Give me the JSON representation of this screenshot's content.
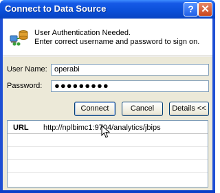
{
  "window": {
    "title": "Connect to Data Source",
    "help_button": "?",
    "close_button": "✕"
  },
  "header": {
    "icon": "data-source-connect-icon",
    "line1": "User Authentication Needed.",
    "line2": "Enter correct username and password to sign on."
  },
  "form": {
    "username_label": "User Name:",
    "username_value": "operabi",
    "password_label": "Password:",
    "password_value": "●●●●●●●●●"
  },
  "buttons": {
    "connect": "Connect",
    "cancel": "Cancel",
    "details": "Details <<"
  },
  "details": {
    "rows": [
      {
        "key": "URL",
        "value": "http://nplbimc1:9704/analytics/jbips"
      }
    ]
  },
  "colors": {
    "titlebar": "#0a4fd8",
    "client_bg": "#ece9d8",
    "border_blue": "#7f9db9"
  }
}
